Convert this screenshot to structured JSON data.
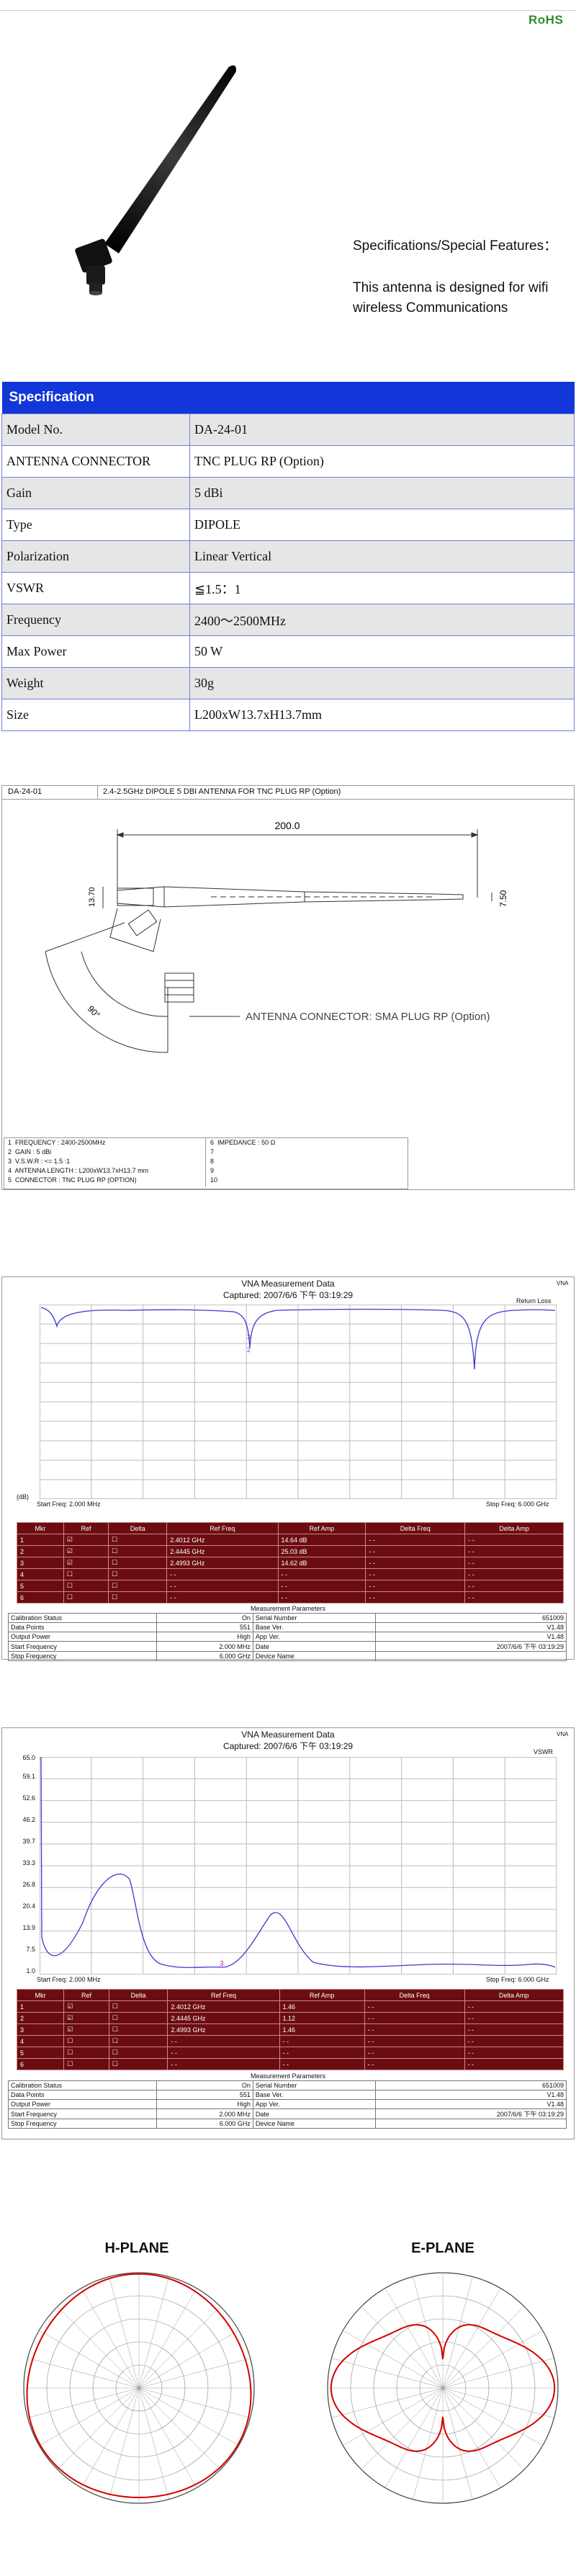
{
  "header": {
    "rohs": "RoHS"
  },
  "hero": {
    "spec_intro": "Specifications/Special Features：",
    "description": "This antenna is designed for wifi wireless Communications"
  },
  "spec_table": {
    "title": "Specification",
    "rows": [
      {
        "label": "Model No.",
        "value": "DA-24-01"
      },
      {
        "label": "ANTENNA CONNECTOR",
        "value": "TNC PLUG RP (Option)"
      },
      {
        "label": "Gain",
        "value": "5 dBi"
      },
      {
        "label": "Type",
        "value": "DIPOLE"
      },
      {
        "label": "Polarization",
        "value": "Linear Vertical"
      },
      {
        "label": "VSWR",
        "value": "≦1.5：1"
      },
      {
        "label": "Frequency",
        "value": "2400～2500MHz"
      },
      {
        "label": "Max Power",
        "value": "50 W"
      },
      {
        "label": "Weight",
        "value": "30g"
      },
      {
        "label": "Size",
        "value": "L200xW13.7xH13.7mm"
      }
    ]
  },
  "drawing": {
    "model": "DA-24-01",
    "title": "2.4-2.5GHz DIPOLE 5 DBI ANTENNA FOR TNC PLUG RP (Option)",
    "dimension_length": "200.0",
    "dimension_dia_left": "13.70",
    "dimension_dia_right": "7.50",
    "angle_label": "90°",
    "connector_note": "ANTENNA CONNECTOR: SMA PLUG RP (Option)",
    "notes": [
      {
        "n": "1",
        "label": "FREQUENCY",
        "value": "2400-2500MHz"
      },
      {
        "n": "2",
        "label": "GAIN",
        "value": "5 dBi"
      },
      {
        "n": "3",
        "label": "V.S.W.R",
        "value": "<= 1.5 :1"
      },
      {
        "n": "4",
        "label": "ANTENNA LENGTH",
        "value": "L200xW13.7xH13.7 mm"
      },
      {
        "n": "5",
        "label": "CONNECTOR",
        "value": "TNC PLUG RP (OPTION)"
      }
    ],
    "notes_right": [
      {
        "n": "6",
        "label": "IMPEDANCE",
        "value": "50 Ω"
      },
      {
        "n": "7",
        "label": "",
        "value": ""
      },
      {
        "n": "8",
        "label": "",
        "value": ""
      },
      {
        "n": "9",
        "label": "",
        "value": ""
      },
      {
        "n": "10",
        "label": "",
        "value": ""
      }
    ]
  },
  "vna1": {
    "title": "VNA Measurement Data",
    "captured": "Captured: 2007/6/6 下午 03:19:29",
    "brand": "VNA",
    "trace_label": "Return Loss",
    "ylabel": "(dB)",
    "start": "Start Freq: 2.000 MHz",
    "stop": "Stop Freq: 6.000 GHz",
    "marker_headers": [
      "Mkr",
      "Ref",
      "Delta",
      "Ref Freq",
      "Ref Amp",
      "Delta Freq",
      "Delta Amp"
    ],
    "markers": [
      {
        "n": "1",
        "freq": "2.4012 GHz",
        "amp": "14.64 dB",
        "dfreq": "- -",
        "damp": "- -"
      },
      {
        "n": "2",
        "freq": "2.4445 GHz",
        "amp": "25.03 dB",
        "dfreq": "- -",
        "damp": "- -"
      },
      {
        "n": "3",
        "freq": "2.4993 GHz",
        "amp": "14.62 dB",
        "dfreq": "- -",
        "damp": "- -"
      },
      {
        "n": "4",
        "freq": "- -",
        "amp": "- -",
        "dfreq": "- -",
        "damp": "- -"
      },
      {
        "n": "5",
        "freq": "- -",
        "amp": "- -",
        "dfreq": "- -",
        "damp": "- -"
      },
      {
        "n": "6",
        "freq": "- -",
        "amp": "- -",
        "dfreq": "- -",
        "damp": "- -"
      }
    ],
    "params_title": "Measurement Parameters",
    "params": [
      [
        "Calibration Status",
        "On",
        "Serial Number",
        "651009"
      ],
      [
        "Data Points",
        "551",
        "Base Ver.",
        "V1.48"
      ],
      [
        "Output Power",
        "High",
        "App Ver.",
        "V1.48"
      ],
      [
        "Start Frequency",
        "2.000 MHz",
        "Date",
        "2007/6/6 下午 03:19:29"
      ],
      [
        "Stop Frequency",
        "6.000 GHz",
        "Device Name",
        ""
      ]
    ]
  },
  "vna2": {
    "title": "VNA Measurement Data",
    "captured": "Captured: 2007/6/6 下午 03:19:29",
    "brand": "VNA",
    "trace_label": "VSWR",
    "yticks": [
      "65.0",
      "59.1",
      "52.6",
      "46.2",
      "39.7",
      "33.3",
      "26.8",
      "20.4",
      "13.9",
      "7.5",
      "1.0"
    ],
    "start": "Start Freq: 2.000 MHz",
    "stop": "Stop Freq: 6.000 GHz",
    "marker_headers": [
      "Mkr",
      "Ref",
      "Delta",
      "Ref Freq",
      "Ref Amp",
      "Delta Freq",
      "Delta Amp"
    ],
    "markers": [
      {
        "n": "1",
        "freq": "2.4012 GHz",
        "amp": "1.46",
        "dfreq": "- -",
        "damp": "- -"
      },
      {
        "n": "2",
        "freq": "2.4445 GHz",
        "amp": "1.12",
        "dfreq": "- -",
        "damp": "- -"
      },
      {
        "n": "3",
        "freq": "2.4993 GHz",
        "amp": "1.46",
        "dfreq": "- -",
        "damp": "- -"
      },
      {
        "n": "4",
        "freq": "- -",
        "amp": "- -",
        "dfreq": "- -",
        "damp": "- -"
      },
      {
        "n": "5",
        "freq": "- -",
        "amp": "- -",
        "dfreq": "- -",
        "damp": "- -"
      },
      {
        "n": "6",
        "freq": "- -",
        "amp": "- -",
        "dfreq": "- -",
        "damp": "- -"
      }
    ],
    "params_title": "Measurement Parameters",
    "params": [
      [
        "Calibration Status",
        "On",
        "Serial Number",
        "651009"
      ],
      [
        "Data Points",
        "551",
        "Base Ver.",
        "V1.48"
      ],
      [
        "Output Power",
        "High",
        "App Ver.",
        "V1.48"
      ],
      [
        "Start Frequency",
        "2.000 MHz",
        "Date",
        "2007/6/6 下午 03:19:29"
      ],
      [
        "Stop Frequency",
        "6.000 GHz",
        "Device Name",
        ""
      ]
    ]
  },
  "patterns": {
    "h_title": "H-PLANE",
    "e_title": "E-PLANE",
    "trace_color": "#d40000"
  },
  "colors": {
    "accent": "#1236d8",
    "marker_bg": "#6b0d10",
    "trace_blue": "#3a3ad0",
    "rohs": "#2e8b2e"
  }
}
